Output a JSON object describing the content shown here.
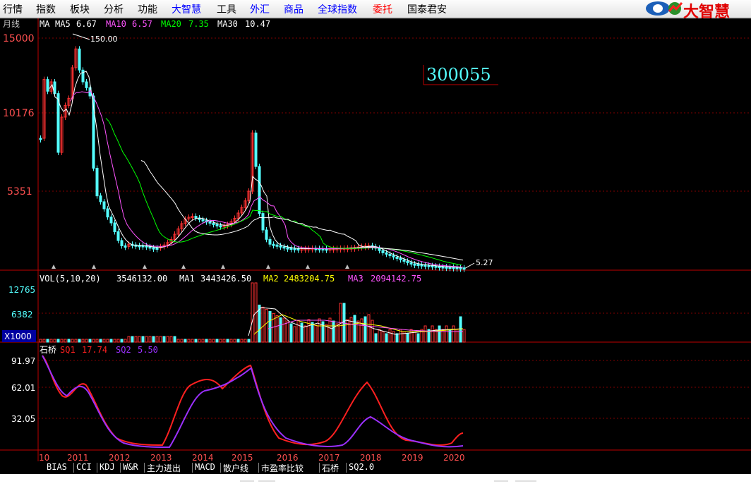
{
  "menu": {
    "items": [
      {
        "label": "行情",
        "color": "black"
      },
      {
        "label": "指数",
        "color": "black"
      },
      {
        "label": "板块",
        "color": "black"
      },
      {
        "label": "分析",
        "color": "black"
      },
      {
        "label": "功能",
        "color": "black"
      },
      {
        "label": "大智慧",
        "color": "blue"
      },
      {
        "label": "工具",
        "color": "black"
      },
      {
        "label": "外汇",
        "color": "blue"
      },
      {
        "label": "商品",
        "color": "blue"
      },
      {
        "label": "全球指数",
        "color": "blue"
      },
      {
        "label": "委托",
        "color": "red"
      },
      {
        "label": "国泰君安",
        "color": "black"
      }
    ],
    "logo_text": "大智慧"
  },
  "chart": {
    "period_label": "月线",
    "stock_code": "300055",
    "ma_line": {
      "ma": "MA",
      "ma5_label": "MA5",
      "ma5_value": "6.67",
      "ma10_label": "MA10",
      "ma10_value": "6.57",
      "ma20_label": "MA20",
      "ma20_value": "7.35",
      "ma30_label": "MA30",
      "ma30_value": "10.47"
    },
    "price_axis": [
      "15000",
      "10176",
      "5351"
    ],
    "high_marker": "150.00",
    "low_marker": "5.27",
    "volume": {
      "title": "VOL(5,10,20)",
      "vol_value": "3546132.00",
      "ma1_label": "MA1",
      "ma1_value": "3443426.50",
      "ma2_label": "MA2",
      "ma2_value": "2483204.75",
      "ma3_label": "MA3",
      "ma3_value": "2094142.75",
      "axis": [
        "12765",
        "6382"
      ],
      "unit": "X1000"
    },
    "indicator": {
      "title": "石桥",
      "sq1_label": "SQ1",
      "sq1_value": "17.74",
      "sq2_label": "SQ2",
      "sq2_value": "5.50",
      "axis": [
        "91.97",
        "62.01",
        "32.05"
      ]
    },
    "x_axis": [
      "10",
      "2011",
      "2012",
      "2013",
      "2014",
      "2015",
      "2016",
      "2017",
      "2018",
      "2019",
      "2020"
    ],
    "colors": {
      "up": "#ff3232",
      "down": "#54ffff",
      "ma5": "#ffffff",
      "ma10": "#ff54ff",
      "ma20": "#00ff00",
      "ma30": "#ffffff",
      "sq1": "#ff2020",
      "sq2": "#9b30ff",
      "axis_red": "#c00000",
      "code": "#54ffff"
    }
  },
  "tabs": [
    "BIAS",
    "CCI",
    "KDJ",
    "W&R",
    "主力进出",
    "MACD",
    "散户线",
    "市盈率比较",
    "石桥",
    "SQ2.0"
  ]
}
